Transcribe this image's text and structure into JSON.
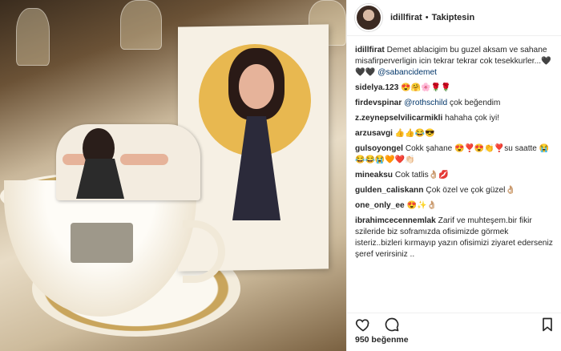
{
  "post": {
    "header": {
      "username": "idillfirat",
      "separator": "•",
      "follow_status": "Takiptesin"
    },
    "caption": {
      "username": "idillfirat",
      "text": "Demet ablacigim bu guzel aksam ve sahane misafirperverligin icin tekrar tekrar cok tesekkurler...🖤🖤🖤",
      "mention": "@sabancidemet"
    },
    "comments": [
      {
        "user": "sidelya.123",
        "text": "😍🤗🌸🌹🌹"
      },
      {
        "user": "firdevspinar",
        "mention": "@rothschild",
        "text": "çok beğendim"
      },
      {
        "user": "z.zeynepselvilicarmikli",
        "text": "hahaha çok iyi!"
      },
      {
        "user": "arzusavgi",
        "text": "👍👍😂😎"
      },
      {
        "user": "gulsoyongel",
        "text": "Cokk şahane 😍❣️😍👏❣️su saatte 😭😂😂😭🧡❤️👏🏻"
      },
      {
        "user": "mineaksu",
        "text": "Cok tatlis👌🏼💋"
      },
      {
        "user": "gulden_caliskann",
        "text": "Çok özel ve çok güzel👌🏼"
      },
      {
        "user": "one_only_ee",
        "text": "😍✨👌🏼"
      },
      {
        "user": "ibrahimcecennemlak",
        "text": "Zarif ve muhteşem.bir fikir szileride biz soframızda ofisimizde görmek isteriz..bizleri kırmayıp yazın ofisimizi ziyaret ederseniz şeref verirsiniz .."
      }
    ],
    "likes": "950 beğenme",
    "icons": [
      "heart-icon",
      "comment-icon",
      "bookmark-icon"
    ]
  }
}
